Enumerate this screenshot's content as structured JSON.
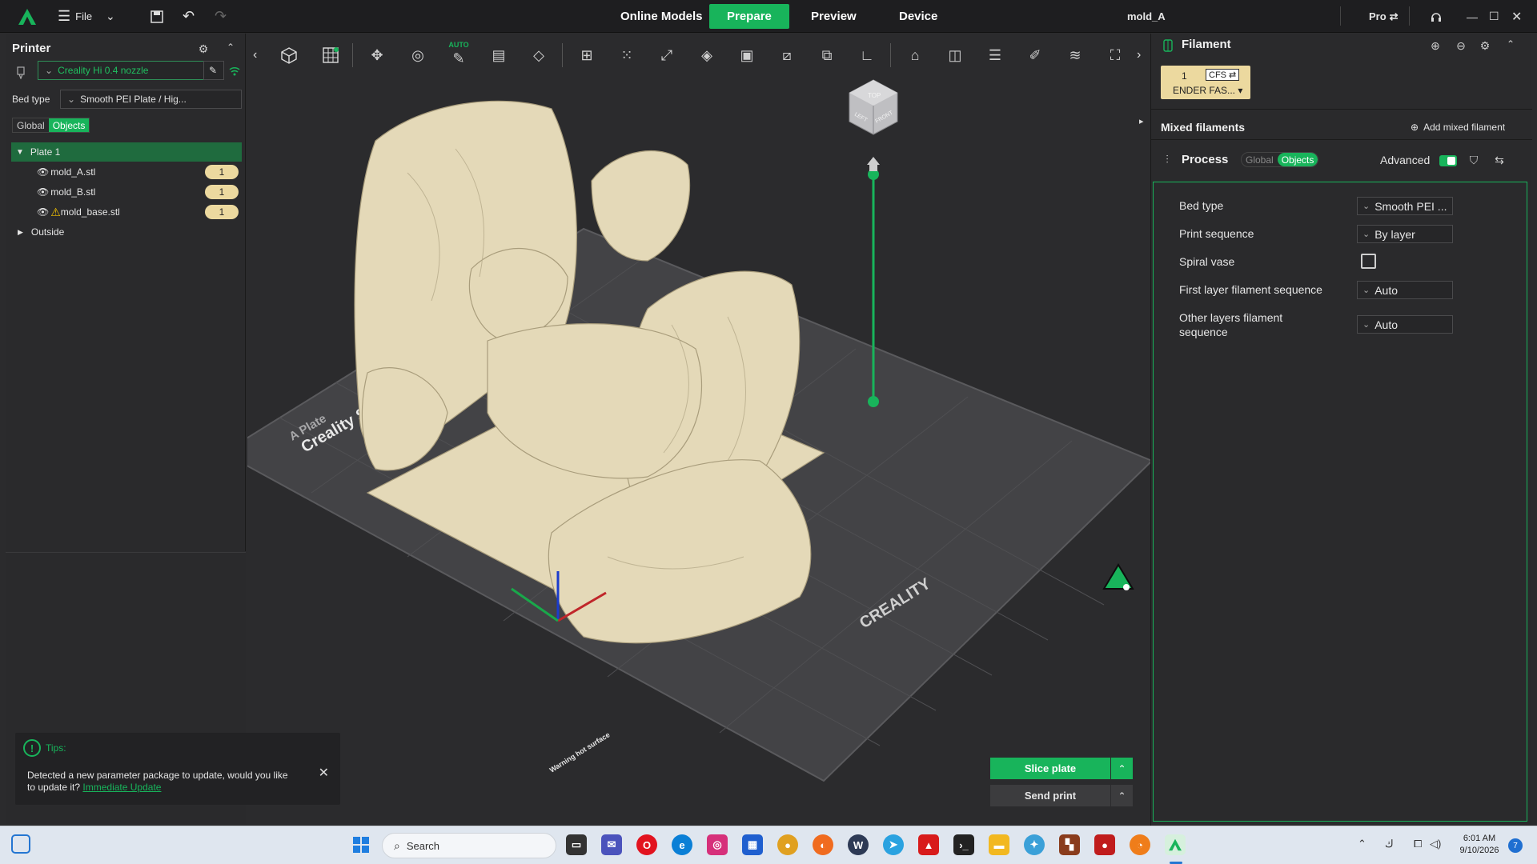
{
  "titlebar": {
    "file_label": "File",
    "tabs": [
      {
        "label": "Online Models"
      },
      {
        "label": "Prepare"
      },
      {
        "label": "Preview"
      },
      {
        "label": "Device"
      }
    ],
    "doc_title": "mold_A",
    "pro_label": "Pro"
  },
  "printer_panel": {
    "title": "Printer",
    "printer_name": "Creality Hi 0.4 nozzle",
    "bed_type_label": "Bed type",
    "bed_type_value": "Smooth PEI Plate / Hig...",
    "toggle_global": "Global",
    "toggle_objects": "Objects",
    "tree": [
      {
        "label": "Plate 1",
        "expanded": true
      },
      {
        "label": "mold_A.stl",
        "count": "1"
      },
      {
        "label": "mold_B.stl",
        "count": "1"
      },
      {
        "label": "mold_base.stl",
        "count": "1",
        "warning": true
      },
      {
        "label": "Outside",
        "expanded": false
      }
    ]
  },
  "tips": {
    "title": "Tips:",
    "message": "Detected a new parameter package to update, would you like to update it?",
    "link": "Immediate Update"
  },
  "toolbar": {
    "auto_label": "AUTO"
  },
  "actions": {
    "slice_label": "Slice plate",
    "send_label": "Send print"
  },
  "filament_panel": {
    "title": "Filament",
    "slot_number": "1",
    "slot_tag": "CFS",
    "slot_name": "ENDER FAS...",
    "slot_color": "#ecd99f",
    "mixed_title": "Mixed filaments",
    "add_mixed_label": "Add mixed filament"
  },
  "process_panel": {
    "title": "Process",
    "toggle_global": "Global",
    "toggle_objects": "Objects",
    "advanced_label": "Advanced",
    "advanced_on": true,
    "properties": [
      {
        "label": "Bed type",
        "value": "Smooth PEI ..."
      },
      {
        "label": "Print sequence",
        "value": "By layer"
      },
      {
        "label": "Spiral vase",
        "checked": false
      },
      {
        "label": "First layer filament sequence",
        "value": "Auto"
      },
      {
        "label": "Other layers filament",
        "label2": "sequence",
        "value": "Auto"
      }
    ]
  },
  "viewport": {
    "bed_texts": [
      "A Plate",
      "Creality Sn",
      "CREALITY",
      "Warning hot surface"
    ],
    "cube_faces": [
      "TOP",
      "LEFT",
      "FRONT"
    ]
  },
  "taskbar": {
    "search_placeholder": "Search",
    "time": "6:01 AM",
    "date": "9/10/2026",
    "notification_count": "7"
  },
  "colors": {
    "accent": "#18b45b",
    "model": "#e4d9b8",
    "background": "#2b2b2d"
  }
}
